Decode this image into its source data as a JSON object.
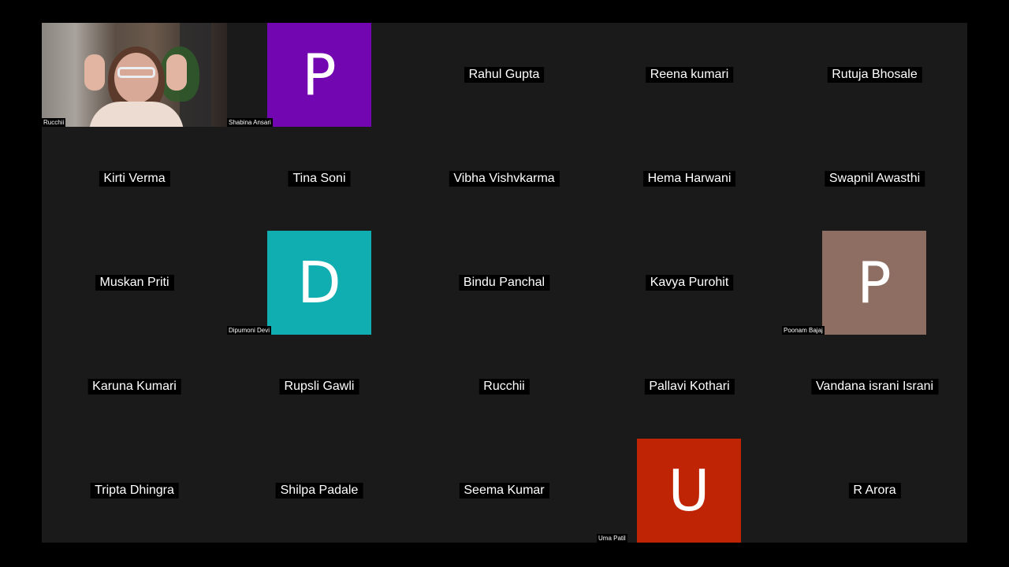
{
  "participants": [
    {
      "name": "Rucchii",
      "type": "video"
    },
    {
      "name": "Shabina Ansari",
      "type": "avatar",
      "letter": "P",
      "color": "#7206b0"
    },
    {
      "name": "Rahul Gupta",
      "type": "name"
    },
    {
      "name": "Reena kumari",
      "type": "name"
    },
    {
      "name": "Rutuja Bhosale",
      "type": "name"
    },
    {
      "name": "Kirti Verma",
      "type": "name"
    },
    {
      "name": "Tina Soni",
      "type": "name"
    },
    {
      "name": "Vibha Vishvkarma",
      "type": "name"
    },
    {
      "name": "Hema Harwani",
      "type": "name"
    },
    {
      "name": "Swapnil Awasthi",
      "type": "name"
    },
    {
      "name": "Muskan Priti",
      "type": "name"
    },
    {
      "name": "Dipumoni Devi",
      "type": "avatar",
      "letter": "D",
      "color": "#10aeb0"
    },
    {
      "name": "Bindu Panchal",
      "type": "name"
    },
    {
      "name": "Kavya Purohit",
      "type": "name"
    },
    {
      "name": "Poonam Bajaj",
      "type": "avatar",
      "letter": "P",
      "color": "#8e6d63"
    },
    {
      "name": "Karuna Kumari",
      "type": "name"
    },
    {
      "name": "Rupsli Gawli",
      "type": "name"
    },
    {
      "name": "Rucchii",
      "type": "name"
    },
    {
      "name": "Pallavi Kothari",
      "type": "name"
    },
    {
      "name": "Vandana israni Israni",
      "type": "name"
    },
    {
      "name": "Tripta Dhingra",
      "type": "name"
    },
    {
      "name": "Shilpa Padale",
      "type": "name"
    },
    {
      "name": "Seema Kumar",
      "type": "name"
    },
    {
      "name": "Uma Patil",
      "type": "avatar",
      "letter": "U",
      "color": "#bf2505"
    },
    {
      "name": "R Arora",
      "type": "name"
    }
  ]
}
